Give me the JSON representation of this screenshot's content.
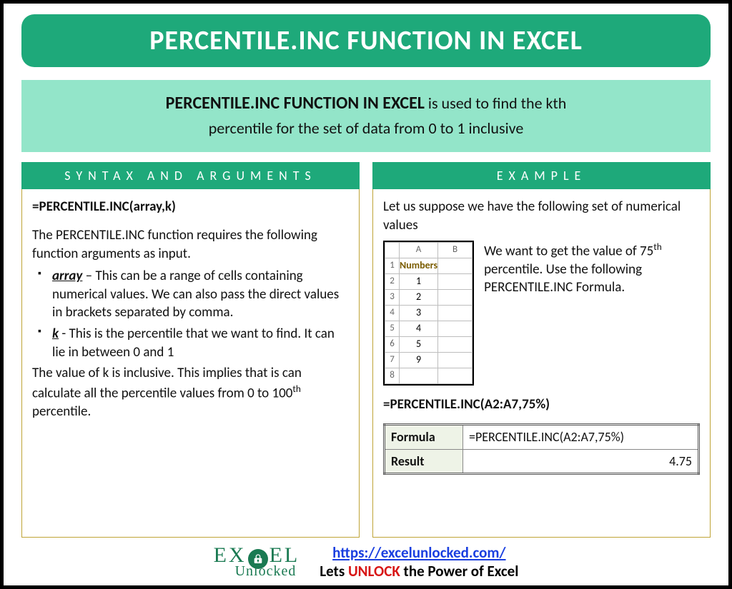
{
  "title": "PERCENTILE.INC FUNCTION IN EXCEL",
  "summary": {
    "lead": "PERCENTILE.INC FUNCTION IN EXCEL",
    "rest1": " is used to find the kth",
    "rest2": "percentile for the set of data from 0 to 1 inclusive"
  },
  "syntax": {
    "header": "SYNTAX AND ARGUMENTS",
    "formula": "=PERCENTILE.INC(array,k)",
    "intro": "The PERCENTILE.INC function requires the following function arguments as input.",
    "args": [
      {
        "name": "array",
        "sep": " – ",
        "desc": "This can be a range of cells containing numerical values. We can also pass the direct values in brackets separated by comma."
      },
      {
        "name": "k",
        "sep": " -  ",
        "desc": "This is the percentile that we want to find. It can lie in between 0 and 1"
      }
    ],
    "note_pre": "The value of k is inclusive. This implies that is can calculate all the percentile values from 0 to 100",
    "note_sup": "th",
    "note_post": " percentile."
  },
  "example": {
    "header": "EXAMPLE",
    "intro": "Let us suppose we have the following set of numerical values",
    "sheet": {
      "cols": [
        "A",
        "B"
      ],
      "header_cell": "Numbers",
      "rows": [
        "1",
        "2",
        "3",
        "4",
        "5",
        "9"
      ],
      "row_labels": [
        "1",
        "2",
        "3",
        "4",
        "5",
        "6",
        "7",
        "8"
      ]
    },
    "desc_pre": "We want to get the value of 75",
    "desc_sup": "th",
    "desc_post": " percentile. Use the following PERCENTILE.INC Formula.",
    "formula": "=PERCENTILE.INC(A2:A7,75%)",
    "result": {
      "formula_label": "Formula",
      "formula_value": "=PERCENTILE.INC(A2:A7,75%)",
      "result_label": "Result",
      "result_value": "4.75"
    }
  },
  "footer": {
    "logo_top_pre": "EX",
    "logo_top_post": "EL",
    "logo_bottom": "Unlocked",
    "url": "https://excelunlocked.com/",
    "tagline_pre": "Lets ",
    "tagline_unlock": "UNLOCK",
    "tagline_post": " the Power of Excel"
  }
}
